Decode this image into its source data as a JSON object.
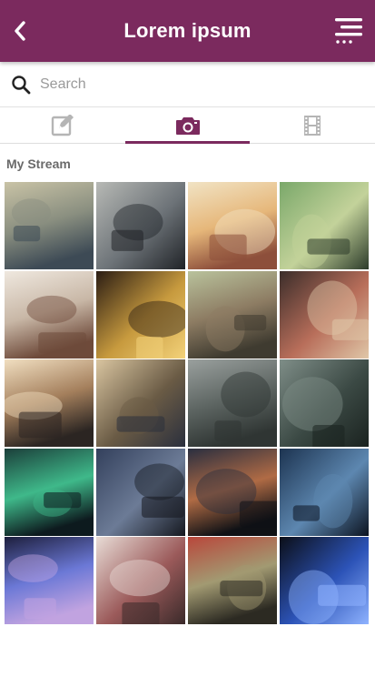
{
  "header": {
    "title": "Lorem ipsum",
    "back_icon": "chevron-left-icon",
    "menu_icon": "menu-lines-icon",
    "color": "#7b2a5e"
  },
  "search": {
    "placeholder": "Search",
    "value": "",
    "icon": "search-icon"
  },
  "tabs": [
    {
      "id": "edit",
      "icon": "edit-icon",
      "active": false
    },
    {
      "id": "camera",
      "icon": "camera-icon",
      "active": true
    },
    {
      "id": "film",
      "icon": "film-icon",
      "active": false
    }
  ],
  "section": {
    "title": "My Stream"
  },
  "photos": [
    {
      "subject": "fountain-dancers",
      "colors": [
        "#c9c3a6",
        "#8a8f80",
        "#3d4a55"
      ]
    },
    {
      "subject": "vintage-camera-hands",
      "colors": [
        "#b7b9b5",
        "#6d7378",
        "#202327"
      ]
    },
    {
      "subject": "girl-with-camera",
      "colors": [
        "#f1e3c4",
        "#e6b77a",
        "#8d4f3b"
      ]
    },
    {
      "subject": "green-camera",
      "colors": [
        "#7aa86a",
        "#c3d29a",
        "#2c3b2a"
      ]
    },
    {
      "subject": "watch-notebook",
      "colors": [
        "#efe8df",
        "#c8b7a6",
        "#6e4a3a"
      ]
    },
    {
      "subject": "camera-with-lights",
      "colors": [
        "#2b1d14",
        "#c79a3e",
        "#f3d27a"
      ]
    },
    {
      "subject": "big-ben-photo",
      "colors": [
        "#b9c29c",
        "#8d7c63",
        "#3f3b30"
      ]
    },
    {
      "subject": "slr-camera-zenit",
      "colors": [
        "#3b2d2a",
        "#b86e5a",
        "#e0c7a8"
      ]
    },
    {
      "subject": "camera-window-light",
      "colors": [
        "#f1dfc1",
        "#a47f5c",
        "#2b2522"
      ]
    },
    {
      "subject": "mountain-cliff-sunset",
      "colors": [
        "#d9c5a0",
        "#6a5b45",
        "#2a2f3d"
      ]
    },
    {
      "subject": "foggy-road-gray",
      "colors": [
        "#9aa09e",
        "#5d6562",
        "#2f3533"
      ]
    },
    {
      "subject": "forest-road-mist",
      "colors": [
        "#7f8e88",
        "#3b4944",
        "#1a221f"
      ]
    },
    {
      "subject": "aurora-lake",
      "colors": [
        "#1b3f3a",
        "#3fb98a",
        "#0d1a1e"
      ]
    },
    {
      "subject": "lonely-barn-dusk",
      "colors": [
        "#33405c",
        "#6c7b96",
        "#15181f"
      ]
    },
    {
      "subject": "road-sunset-dark",
      "colors": [
        "#2a2e3f",
        "#b06b45",
        "#0f1115"
      ]
    },
    {
      "subject": "starry-shipwreck",
      "colors": [
        "#1c3350",
        "#5d87b0",
        "#0b1320"
      ]
    },
    {
      "subject": "light-fibers",
      "colors": [
        "#1d1f3d",
        "#6b78d6",
        "#c1a3e0"
      ]
    },
    {
      "subject": "film-strip-flowers",
      "colors": [
        "#e8dcd6",
        "#9b5a5a",
        "#3a2a2a"
      ]
    },
    {
      "subject": "lens-closeup-red",
      "colors": [
        "#b9473b",
        "#a29a72",
        "#2c2a22"
      ]
    },
    {
      "subject": "lubitel-blue-camera",
      "colors": [
        "#0b0e17",
        "#2c53b7",
        "#8fb3ff"
      ]
    }
  ]
}
